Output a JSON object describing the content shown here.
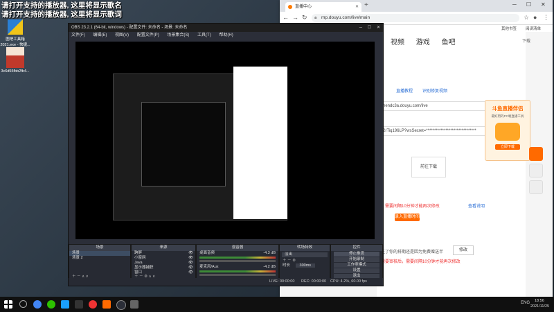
{
  "desktop": {
    "lyric_line1": "请打开支持的播放器, 这里将显示歌名",
    "lyric_line2": "请打开支持的播放器, 这里将显示歌词",
    "icon1_label": "图吧工具箱",
    "icon1_sub": "2021.exe - 快捷...",
    "icon2_label": "3c6d55fbb2fb4..."
  },
  "browser": {
    "tab_title": "直播中心",
    "url": "mp.douyu.com/live/main",
    "bookmark1": "其他书签",
    "bookmark2": "阅读清单",
    "nav_items": [
      "视频",
      "游戏",
      "鱼吧"
    ],
    "download": "下载",
    "link1": "直播教程",
    "link2": "识别修复视频",
    "server_url": "hendc3a.douyu.com/live",
    "stream_key": "2rTiq196LP?wsSecret=*******************************",
    "client_download": "前往下载",
    "notice": "，需要间隔10分钟才能再次修改",
    "notice_link": "查看说明",
    "apply_btn": "录入直播时间",
    "notice2": "注了你的排期还是因为免费赠送半",
    "modify_btn": "修改",
    "notice3": "需要审核后，需要间隔10分钟才能再次修改",
    "ad_title": "斗鱼直播伴侣",
    "ad_sub": "最好用的PC端直播工具",
    "ad_btn": "立即下载"
  },
  "obs": {
    "title": "OBS 23.2.1 (64-bit, windows) - 配置文件: 未命名 - 场景: 未命名",
    "menu": [
      "文件(F)",
      "编辑(E)",
      "视图(V)",
      "配置文件(P)",
      "场景集合(S)",
      "工具(T)",
      "帮助(H)"
    ],
    "scenes_header": "场景",
    "scenes": [
      "场景",
      "场景 2"
    ],
    "sources_header": "来源",
    "sources": [
      "跨屏",
      "小窗网",
      "Java",
      "显示器捕获",
      "窗口"
    ],
    "mixer_header": "混音器",
    "mixer": [
      {
        "name": "桌面音频",
        "db": "-4.3 dB"
      },
      {
        "name": "麦克风/Aux",
        "db": "-4.2 dB"
      }
    ],
    "transition_header": "转场特效",
    "transition_value": "淡出",
    "duration_label": "时长",
    "duration_value": "300ms",
    "controls_header": "控件",
    "controls": [
      "停止推流",
      "开始录制",
      "工作室模式",
      "设置",
      "退出"
    ],
    "status": {
      "live": "LIVE: 00:00:00",
      "rec": "REC: 00:00:00",
      "cpu": "CPU: 4.2%, 60.00 fps"
    }
  },
  "taskbar": {
    "lang": "ENG",
    "time": "18:56",
    "date": "2021/11/25"
  }
}
